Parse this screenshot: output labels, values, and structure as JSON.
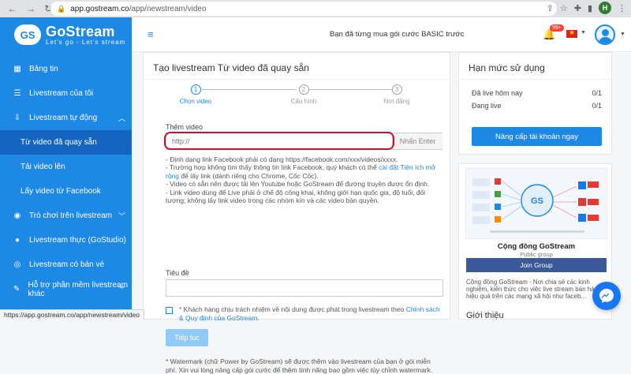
{
  "browser": {
    "url_host": "app.gostream.co",
    "url_path": "/app/newstream/video",
    "profile_initial": "H"
  },
  "brand": {
    "name": "GoStream",
    "tagline": "Let's go - Let's stream",
    "primary_color": "#1e88e5"
  },
  "sidebar": {
    "items": [
      {
        "label": "Bảng tin",
        "icon": "dashboard-icon"
      },
      {
        "label": "Livestream của tôi",
        "icon": "list-icon"
      },
      {
        "label": "Livestream tự động",
        "icon": "auto-stream-icon"
      },
      {
        "label": "Từ video đã quay sẵn"
      },
      {
        "label": "Tải video lên"
      },
      {
        "label": "Lấy video từ Facebook"
      },
      {
        "label": "Trò chơi trên livestream",
        "icon": "game-icon"
      },
      {
        "label": "Livestream thực (GoStudio)",
        "icon": "studio-icon"
      },
      {
        "label": "Livestream có bán vé",
        "icon": "ticket-icon"
      },
      {
        "label": "Hỗ trợ phần mềm livestream khác",
        "icon": "software-icon"
      }
    ]
  },
  "header": {
    "notice": "Bạn đã từng mua gói cước BASIC trước",
    "notification_count": "99+"
  },
  "main": {
    "title": "Tạo livestream Từ video đã quay sẵn",
    "steps": [
      {
        "num": "1",
        "label": "Chọn video"
      },
      {
        "num": "2",
        "label": "Cấu hình"
      },
      {
        "num": "3",
        "label": "Nơi đăng"
      }
    ],
    "add_video_label": "Thêm video",
    "url_placeholder": "http://",
    "enter_label": "Nhấn Enter",
    "notes": {
      "n1": "- Định dạng link Facebook phải có dạng https://facebook.com/xxx/videos/xxxx.",
      "n2a": "- Trường hợp không tìm thấy thông tin link Facebook, quý khách có thể ",
      "n2link": "cài đặt Tiện ích mở rộng",
      "n2b": " để lấy link (dành riêng cho Chrome, Cốc Cốc).",
      "n3": "- Video có sẵn nên được tải lên Youtube hoặc GoStream để đường truyền được ổn định.",
      "n4": "- Link video dùng để Live phải ở chế độ công khai, không giới hạn quốc gia, độ tuổi, đối tượng; không lấy link video trong các nhóm kín và các video bản quyền."
    },
    "title_label": "Tiêu đề",
    "agree": {
      "star": "* ",
      "text": "Khách hàng chịu trách nhiệm về nội dung được phát trong livestream theo ",
      "link": "Chính sách & Quy định của GoStream",
      "end": "."
    },
    "next_label": "Tiếp tục",
    "watermark_note": "* Watermark (chữ Power by GoStream) sẽ được thêm vào livestream của bạn ở gói miễn phí. Xin vui lòng nâng cấp gói cước để thêm tính năng bao gồm việc tùy chỉnh watermark."
  },
  "limits": {
    "title": "Hạn mức sử dụng",
    "rows": [
      {
        "label": "Đã live hôm nay",
        "value": "0/1"
      },
      {
        "label": "Đang live",
        "value": "0/1"
      }
    ],
    "upgrade_label": "Nâng cấp tài khoản ngay"
  },
  "community": {
    "name": "Cộng đồng GoStream",
    "type": "Public group",
    "join_label": "Join Group",
    "description": "Cộng đồng GoStream - Nơi chia sẻ các kinh nghiệm, kiến thức cho việc live stream bán hàng hiệu quả trên các mạng xã hội như faceb...",
    "intro_heading": "Giới thiệu"
  },
  "status_url": "https://app.gostream.co/app/newstream/video"
}
